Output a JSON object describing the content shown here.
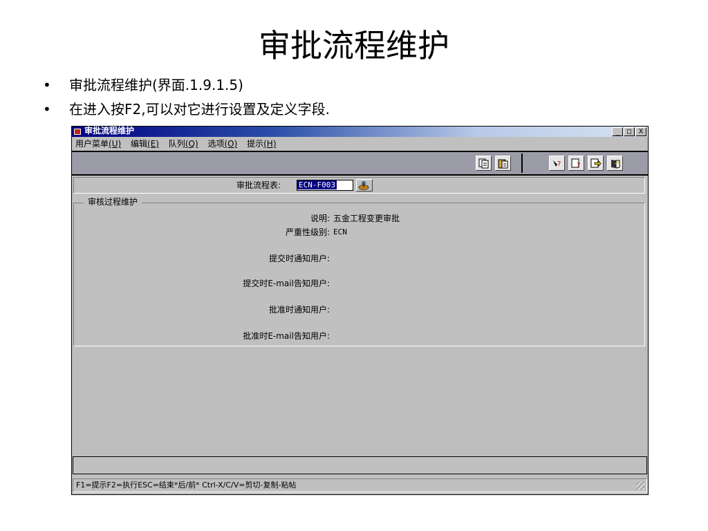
{
  "slide": {
    "title": "审批流程维护",
    "bullets": [
      {
        "marker": "•",
        "text": "审批流程维护(界面.1.9.1.5)"
      },
      {
        "marker": "•",
        "text": "在进入按F2,可以对它进行设置及定义字段."
      }
    ]
  },
  "window": {
    "title": "审批流程维护",
    "controls": {
      "minimize": "_",
      "restore": "□",
      "close": "X"
    },
    "menu": [
      {
        "label": "用户菜单",
        "accel": "(U)"
      },
      {
        "label": "编辑",
        "accel": "(E)"
      },
      {
        "label": "队列",
        "accel": "(Q)"
      },
      {
        "label": "选项",
        "accel": "(O)"
      },
      {
        "label": "提示",
        "accel": "(H)"
      }
    ],
    "toolbar_icons": [
      "copy-icon",
      "paste-icon",
      "query-icon",
      "edit-query-icon",
      "export-icon",
      "exit-icon"
    ],
    "selector": {
      "label": "审批流程表:",
      "value": "ECN-F003",
      "lookup_icon": "lookup-icon"
    },
    "group": {
      "title": "审核过程维护",
      "fields": [
        {
          "label": "说明:",
          "value": "五金工程变更审批"
        },
        {
          "label": "严重性级别:",
          "value": "ECN"
        },
        {
          "label": "提交时通知用户:",
          "value": ""
        },
        {
          "label": "提交时E-mail告知用户:",
          "value": ""
        },
        {
          "label": "批准时通知用户:",
          "value": ""
        },
        {
          "label": "批准时E-mail告知用户:",
          "value": ""
        }
      ]
    },
    "status": "F1=提示F2=执行ESC=结束*后/前* Ctrl-X/C/V=剪切-复制-粘帖"
  }
}
